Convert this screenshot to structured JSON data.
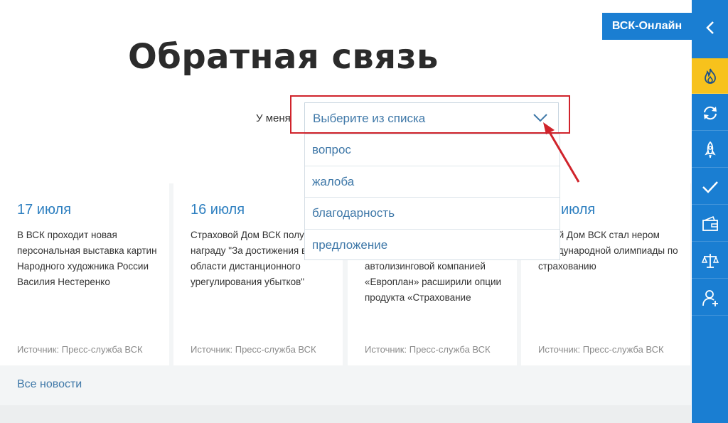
{
  "page": {
    "title": "Обратная связь"
  },
  "form": {
    "label": "У меня",
    "select_placeholder": "Выберите из списка",
    "options": [
      "вопрос",
      "жалоба",
      "благодарность",
      "предложение"
    ]
  },
  "news": {
    "cards": [
      {
        "date": "17 июля",
        "text": "В ВСК проходит новая персональная выставка картин Народного художника России Василия Нестеренко",
        "source": "Источник: Пресс-служба ВСК"
      },
      {
        "date": "16 июля",
        "text": "Страховой Дом ВСК получил награду \"За достижения в области дистанционного урегулирования убытков\"",
        "source": "Источник: Пресс-служба ВСК"
      },
      {
        "date": "",
        "text": "автолизинговой компанией «Европлан» расширили опции продукта «Страхование",
        "source": "Источник: Пресс-служба ВСК"
      },
      {
        "date": "июля",
        "text": "ховой Дом ВСК стал нером Международной олимпиады по страхованию",
        "source": "Источник: Пресс-служба ВСК"
      }
    ],
    "all_news_label": "Все новости"
  },
  "header": {
    "online_button": "ВСК-Онлайн"
  },
  "sidebar": {
    "items": [
      {
        "icon": "fire-icon",
        "active": true
      },
      {
        "icon": "refresh-icon",
        "active": false
      },
      {
        "icon": "rocket-icon",
        "active": false
      },
      {
        "icon": "check-icon",
        "active": false
      },
      {
        "icon": "wallet-icon",
        "active": false
      },
      {
        "icon": "scales-icon",
        "active": false
      },
      {
        "icon": "person-add-icon",
        "active": false
      }
    ]
  },
  "colors": {
    "brand_blue": "#1a7ed2",
    "accent_yellow": "#f7c21c",
    "highlight_red": "#d0232b",
    "link_blue": "#3f78a8"
  }
}
